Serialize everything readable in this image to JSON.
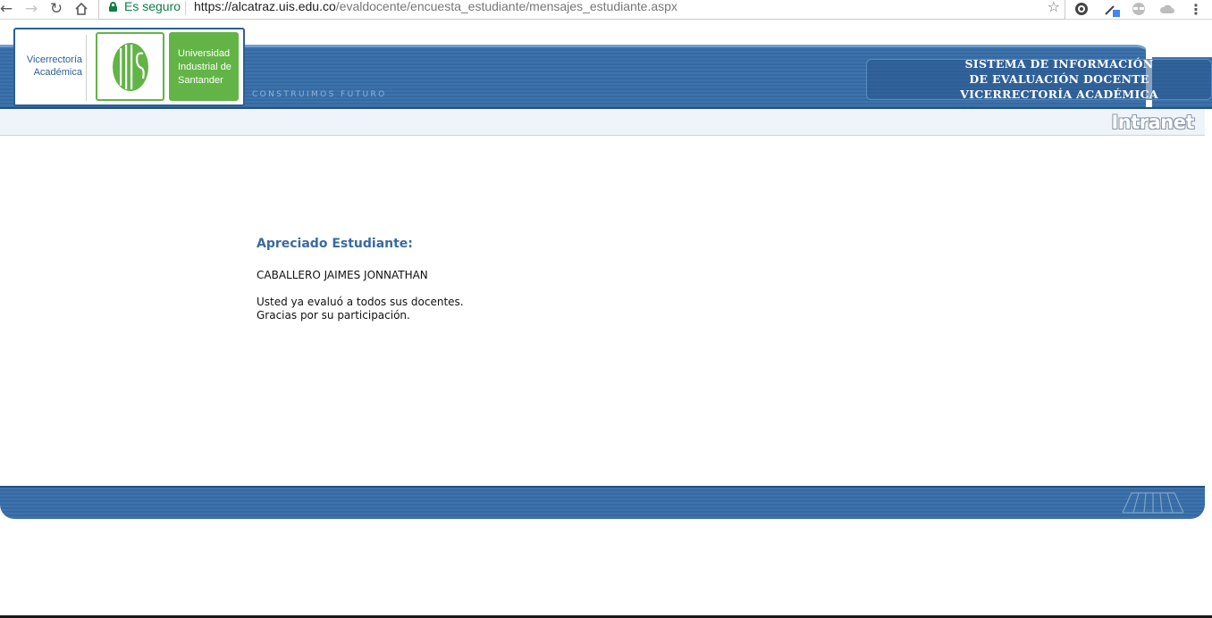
{
  "browser": {
    "secure_label": "Es seguro",
    "url_host": "https://alcatraz.uis.edu.co",
    "url_path": "/evaldocente/encuesta_estudiante/mensajes_estudiante.aspx"
  },
  "header": {
    "vicerrectoria_line1": "Vicerrectoría",
    "vicerrectoria_line2": "Académica",
    "uis_name_line1": "Universidad",
    "uis_name_line2": "Industrial de",
    "uis_name_line3": "Santander",
    "tagline": "CONSTRUIMOS FUTURO",
    "system_title_line1": "SISTEMA DE INFORMACIÓN",
    "system_title_line2": "DE EVALUACIÓN DOCENTE",
    "system_title_line3": "VICERRECTORÍA ACADÉMICA",
    "intranet_label": "Intranet"
  },
  "main": {
    "greeting": "Apreciado Estudiante:",
    "student_name": "CABALLERO JAIMES JONNATHAN",
    "message_line1": "Usted ya evaluó a todos sus docentes.",
    "message_line2": "Gracias por su participación."
  },
  "colors": {
    "header_blue": "#3669a1",
    "uis_green": "#62b446",
    "greeting_blue": "#3b6aa0",
    "secure_green": "#0b8043"
  }
}
